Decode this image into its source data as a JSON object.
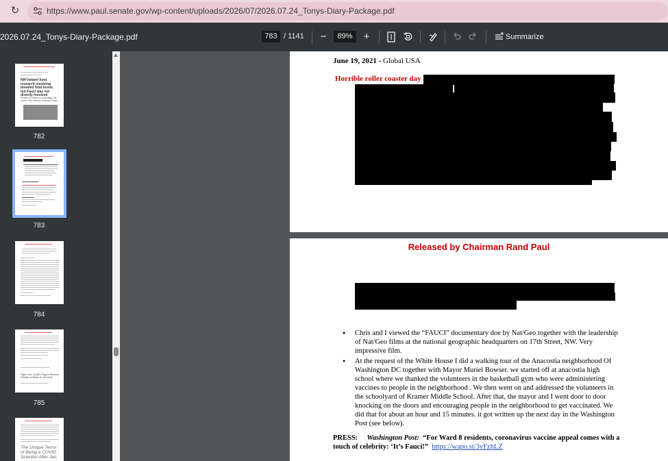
{
  "browser": {
    "url": "https://www.paul.senate.gov/wp-content/uploads/2026/07/2026.07.24_Tonys-Diary-Package.pdf",
    "reload_icon": "↻"
  },
  "toolbar": {
    "doc_title": "2026.07.24_Tonys-Diary-Package.pdf",
    "page_current": "783",
    "page_total": "/ 1141",
    "zoom_out": "−",
    "zoom_value": "89%",
    "zoom_in": "+",
    "summarize_label": "Summarize"
  },
  "thumbnails": [
    {
      "page": "782",
      "heading": "NIH helped fund research involving donated fetal tissue, but Fauci was not directly involved",
      "sub": "People it's linked to potentially the former NIH Director Anthony Fauci"
    },
    {
      "page": "783"
    },
    {
      "page": "784"
    },
    {
      "page": "785",
      "heading": "Fight Over Covid's Origins Renews Debate on Risks of Lab Work"
    },
    {
      "page": "786",
      "heading": "The Unique Terror of Being a COVID Scientist After Jan."
    }
  ],
  "page_783": {
    "date": "June 19, 2021 -",
    "location": "Global   USA",
    "note": "Horrible roller coaster day"
  },
  "page_784": {
    "header": "Released by Chairman Rand Paul",
    "bullets": [
      "Chris and I viewed the “FAUCI” documentary doe by Nat/Geo together with the leadership of Nat/Geo films at the national geographic headquarters on 17th Street, NW. Very impressive film.",
      "At the request of the White House I did a walking tour of the Anacostia neighborhood Of Washington DC together with Mayor Muriel Bowser. we started off at anacostia high school where we thanked the volunteers in the basketball gym who were administering vaccines to people in the neighborhood . We then went on and addressed the volunteers in the schoolyard of Kramer Middle School.  After that, the mayor and I went door to door knocking on the doors and encouraging people in the neighborhood to get vaccinated. We did that for about an hour and 15 minutes. it got written up the next day in the Washington Post (see below)."
    ],
    "press_label": "PRESS:",
    "press_source": "Washington Post:",
    "press_headline": "“For Ward 8 residents, coronavirus vaccine appeal comes with a touch of celebrity: ‘It’s Fauci!”",
    "press_link": "https://wapo.st/3vFzhLZ"
  }
}
